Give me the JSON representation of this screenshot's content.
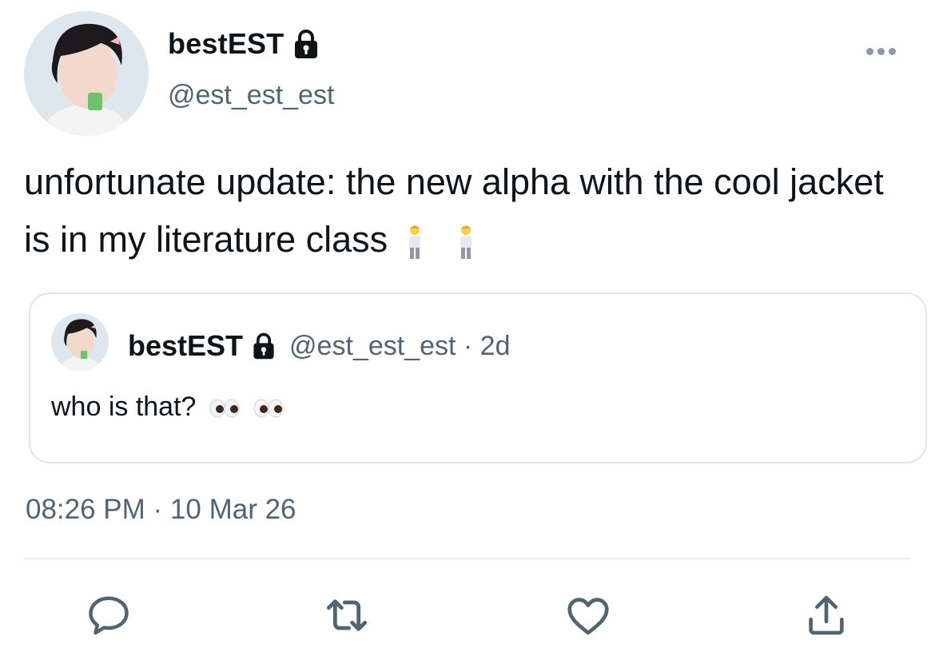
{
  "author": {
    "display_name": "bestEST",
    "handle": "@est_est_est",
    "protected_icon": "lock-icon"
  },
  "tweet": {
    "text": "unfortunate update: the new alpha with the cool jacket is in my literature class",
    "emoji": [
      "man-standing",
      "man-standing"
    ]
  },
  "quoted_tweet": {
    "display_name": "bestEST",
    "handle_time": "@est_est_est · 2d",
    "text": "who is that?",
    "emoji": [
      "eyes",
      "eyes"
    ]
  },
  "timestamp": "08:26 PM · 10 Mar 26",
  "actions": [
    "reply-icon",
    "retweet-icon",
    "like-icon",
    "share-icon"
  ],
  "colors": {
    "text": "#0f1419",
    "secondary": "#536471",
    "icon": "#536471",
    "border": "#dfe5ea"
  }
}
